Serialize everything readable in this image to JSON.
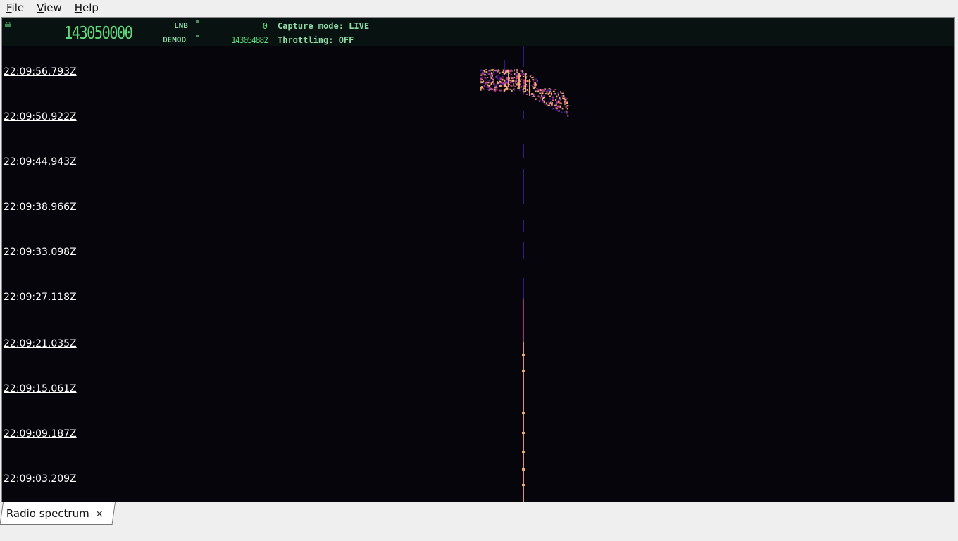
{
  "menu": [
    {
      "mnemonic": "F",
      "rest": "ile"
    },
    {
      "mnemonic": "V",
      "rest": "iew"
    },
    {
      "mnemonic": "H",
      "rest": "elp"
    }
  ],
  "header": {
    "center_frequency": "143050000",
    "lnb_label": "LNB",
    "lnb_value": "0",
    "demod_label": "DEMOD",
    "demod_value": "143054882",
    "capture_mode": "Capture mode: LIVE",
    "throttling": "Throttling: OFF"
  },
  "timestamps": [
    "22:09:56.793Z",
    "22:09:50.922Z",
    "22:09:44.943Z",
    "22:09:38.966Z",
    "22:09:33.098Z",
    "22:09:27.118Z",
    "22:09:21.035Z",
    "22:09:15.061Z",
    "22:09:09.187Z",
    "22:09:03.209Z"
  ],
  "tabs": [
    {
      "label": "Radio spectrum",
      "close": "×"
    }
  ],
  "colors": {
    "waterfall_background": "#05050b",
    "header_text": "#7fd39a",
    "signal_low": "#3a1a8f",
    "signal_mid": "#c23b8a",
    "signal_high": "#ffb377"
  }
}
